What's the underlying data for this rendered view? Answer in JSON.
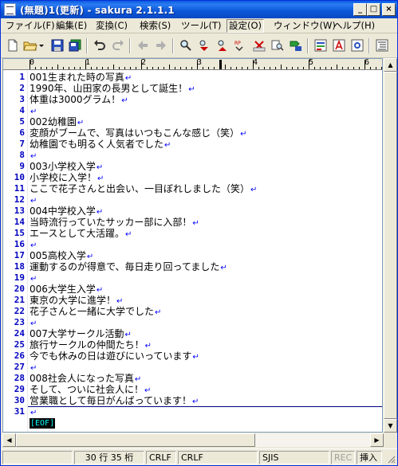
{
  "window": {
    "title": "(無題)1(更新) - sakura 2.1.1.1",
    "minimize_glyph": "_",
    "maximize_glyph": "□",
    "close_glyph": "×"
  },
  "menu": {
    "items": [
      {
        "label": "ファイル(F)"
      },
      {
        "label": "編集(E)"
      },
      {
        "label": "変換(C)"
      },
      {
        "label": "検索(S)"
      },
      {
        "label": "ツール(T)"
      },
      {
        "label": "設定(O)"
      },
      {
        "label": "ウィンドウ(W)"
      },
      {
        "label": "ヘルプ(H)"
      }
    ]
  },
  "toolbar": {
    "icons": [
      "new-file-icon",
      "open-folder-icon",
      "dropdown-arrow-icon",
      "save-icon",
      "save-all-icon",
      "undo-icon",
      "redo-icon",
      "jump-back-icon",
      "jump-forward-icon",
      "search-icon",
      "find-prev-icon",
      "find-next-icon",
      "replace-icon",
      "clear-marks-icon",
      "grep-icon",
      "type-settings-icon",
      "common-settings-icon",
      "font-icon",
      "outline-icon"
    ]
  },
  "ruler": {
    "numbers": [
      "0",
      "1",
      "2",
      "3",
      "4",
      "5",
      "6"
    ]
  },
  "editor": {
    "lines": [
      {
        "no": "1",
        "text": "001生まれた時の写真"
      },
      {
        "no": "2",
        "text": "1990年、山田家の長男として誕生！"
      },
      {
        "no": "3",
        "text": "体重は3000グラム！"
      },
      {
        "no": "4",
        "text": ""
      },
      {
        "no": "5",
        "text": "002幼稚園"
      },
      {
        "no": "6",
        "text": "変顔がブームで、写真はいつもこんな感じ（笑）"
      },
      {
        "no": "7",
        "text": "幼稚園でも明るく人気者でした"
      },
      {
        "no": "8",
        "text": ""
      },
      {
        "no": "9",
        "text": "003小学校入学"
      },
      {
        "no": "10",
        "text": "小学校に入学！"
      },
      {
        "no": "11",
        "text": "ここで花子さんと出会い、一目ぼれしました（笑）"
      },
      {
        "no": "12",
        "text": ""
      },
      {
        "no": "13",
        "text": "004中学校入学"
      },
      {
        "no": "14",
        "text": "当時流行っていたサッカー部に入部！"
      },
      {
        "no": "15",
        "text": "エースとして大活躍。"
      },
      {
        "no": "16",
        "text": ""
      },
      {
        "no": "17",
        "text": "005高校入学"
      },
      {
        "no": "18",
        "text": "運動するのが得意で、毎日走り回ってました"
      },
      {
        "no": "19",
        "text": ""
      },
      {
        "no": "20",
        "text": "006大学生入学"
      },
      {
        "no": "21",
        "text": "東京の大学に進学！"
      },
      {
        "no": "22",
        "text": "花子さんと一緒に大学でした"
      },
      {
        "no": "23",
        "text": ""
      },
      {
        "no": "24",
        "text": "007大学サークル活動"
      },
      {
        "no": "25",
        "text": "旅行サークルの仲間たち！"
      },
      {
        "no": "26",
        "text": "今でも休みの日は遊びにいっています"
      },
      {
        "no": "27",
        "text": ""
      },
      {
        "no": "28",
        "text": "008社会人になった写真"
      },
      {
        "no": "29",
        "text": "そして、ついに社会人に！"
      },
      {
        "no": "30",
        "text": "営業職として毎日がんばっています！"
      },
      {
        "no": "31",
        "text": ""
      }
    ],
    "return_mark": "↵",
    "eof_marker": "[EOF]"
  },
  "status": {
    "position": "30 行  35 桁",
    "eol1": "CRLF",
    "eol2": "CRLF",
    "encoding": "SJIS",
    "rec": "REC",
    "mode": "挿入"
  },
  "colors": {
    "titlebar": "#0a5ae0",
    "line_number": "#0000c0",
    "return_mark": "#0000ff",
    "eof_fg": "#00ffff",
    "eof_bg": "#000000"
  }
}
